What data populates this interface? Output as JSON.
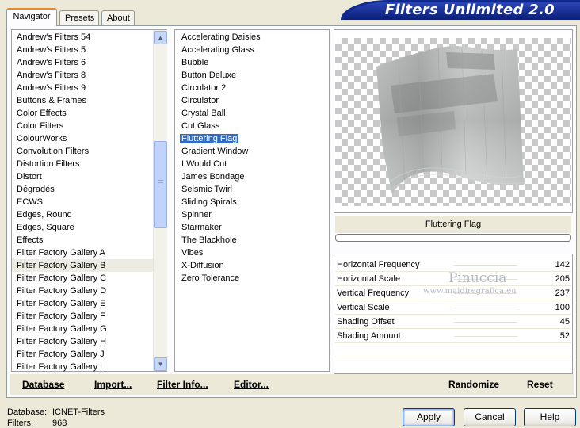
{
  "app": {
    "banner_title": "Filters Unlimited 2.0"
  },
  "tabs": [
    {
      "label": "Navigator",
      "active": true
    },
    {
      "label": "Presets",
      "active": false
    },
    {
      "label": "About",
      "active": false
    }
  ],
  "categories": [
    "Andrew's Filters 54",
    "Andrew's Filters 5",
    "Andrew's Filters 6",
    "Andrew's Filters 8",
    "Andrew's Filters 9",
    "Buttons & Frames",
    "Color Effects",
    "Color Filters",
    "ColourWorks",
    "Convolution Filters",
    "Distortion Filters",
    "Distort",
    "Dégradés",
    "ECWS",
    "Edges, Round",
    "Edges, Square",
    "Effects",
    "Filter Factory Gallery A",
    "Filter Factory Gallery B",
    "Filter Factory Gallery C",
    "Filter Factory Gallery D",
    "Filter Factory Gallery E",
    "Filter Factory Gallery F",
    "Filter Factory Gallery G",
    "Filter Factory Gallery H",
    "Filter Factory Gallery J",
    "Filter Factory Gallery L"
  ],
  "selected_category": "Filter Factory Gallery B",
  "filters": [
    "Accelerating Daisies",
    "Accelerating Glass",
    "Bubble",
    "Button Deluxe",
    "Circulator 2",
    "Circulator",
    "Crystal Ball",
    "Cut Glass",
    "Fluttering Flag",
    "Gradient Window",
    "I Would Cut",
    "James Bondage",
    "Seismic Twirl",
    "Sliding Spirals",
    "Spinner",
    "Starmaker",
    "The Blackhole",
    "Vibes",
    "X-Diffusion",
    "Zero Tolerance"
  ],
  "selected_filter": "Fluttering Flag",
  "toolbar": {
    "database": "Database",
    "import": "Import...",
    "filter_info": "Filter Info...",
    "editor": "Editor...",
    "randomize": "Randomize",
    "reset": "Reset"
  },
  "filter_name": "Fluttering Flag",
  "progress": 0,
  "parameters": [
    {
      "label": "Horizontal Frequency",
      "value": "142"
    },
    {
      "label": "Horizontal Scale",
      "value": "205"
    },
    {
      "label": "Vertical Frequency",
      "value": "237"
    },
    {
      "label": "Vertical Scale",
      "value": "100"
    },
    {
      "label": "Shading Offset",
      "value": "45"
    },
    {
      "label": "Shading Amount",
      "value": "52"
    }
  ],
  "watermark": {
    "name": "Pinuccia",
    "url": "www.maidiregrafica.eu"
  },
  "status": {
    "database_label": "Database:",
    "database_value": "ICNET-Filters",
    "filters_label": "Filters:",
    "filters_value": "968"
  },
  "buttons": {
    "apply": "Apply",
    "cancel": "Cancel",
    "help": "Help"
  },
  "colors": {
    "selection": "#316ac5",
    "banner": "#0f2a8a",
    "tab_accent": "#e68b2c"
  }
}
